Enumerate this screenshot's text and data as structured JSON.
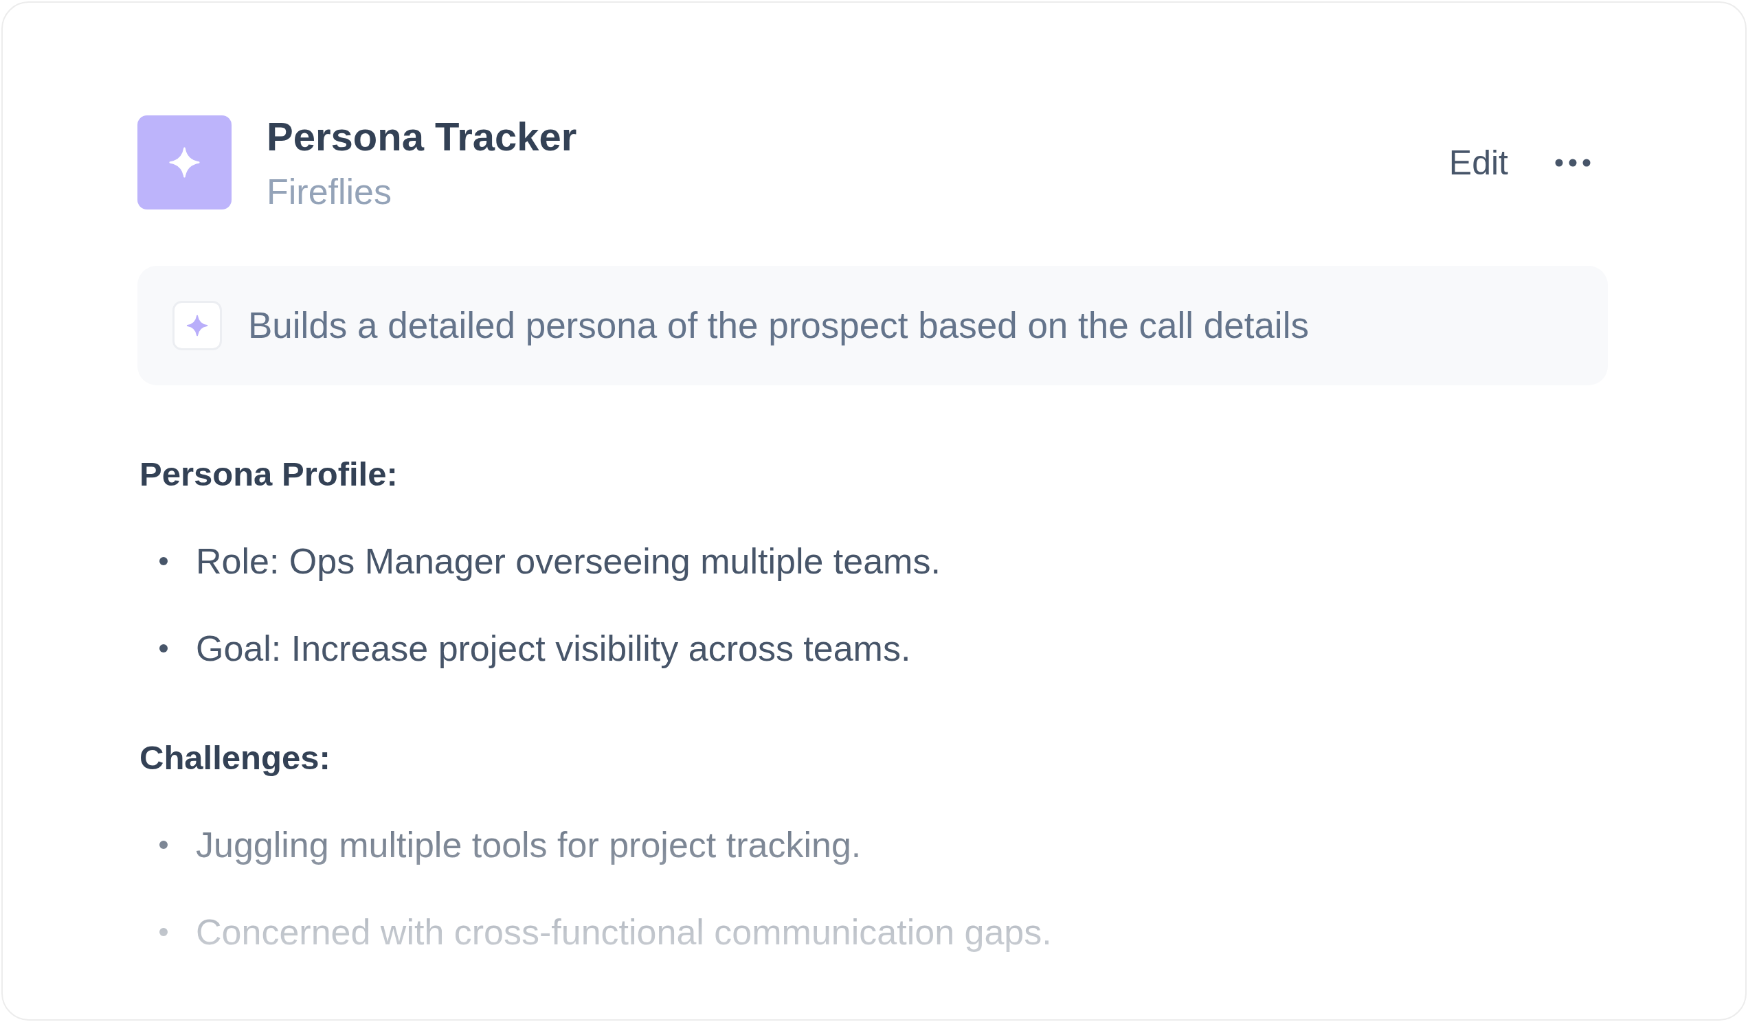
{
  "header": {
    "title": "Persona Tracker",
    "subtitle": "Fireflies",
    "actions": [
      {
        "kind": "text",
        "label": "Edit"
      },
      {
        "kind": "more"
      }
    ]
  },
  "description": {
    "text": "Builds a detailed persona of the prospect based on the call details"
  },
  "sections": [
    {
      "heading": "Persona Profile:",
      "items": [
        "Role: Ops Manager overseeing multiple teams.",
        "Goal: Increase project visibility across teams."
      ]
    },
    {
      "heading": "Challenges:",
      "items": [
        "Juggling multiple tools for project tracking.",
        "Concerned with cross-functional communication gaps."
      ]
    }
  ]
}
